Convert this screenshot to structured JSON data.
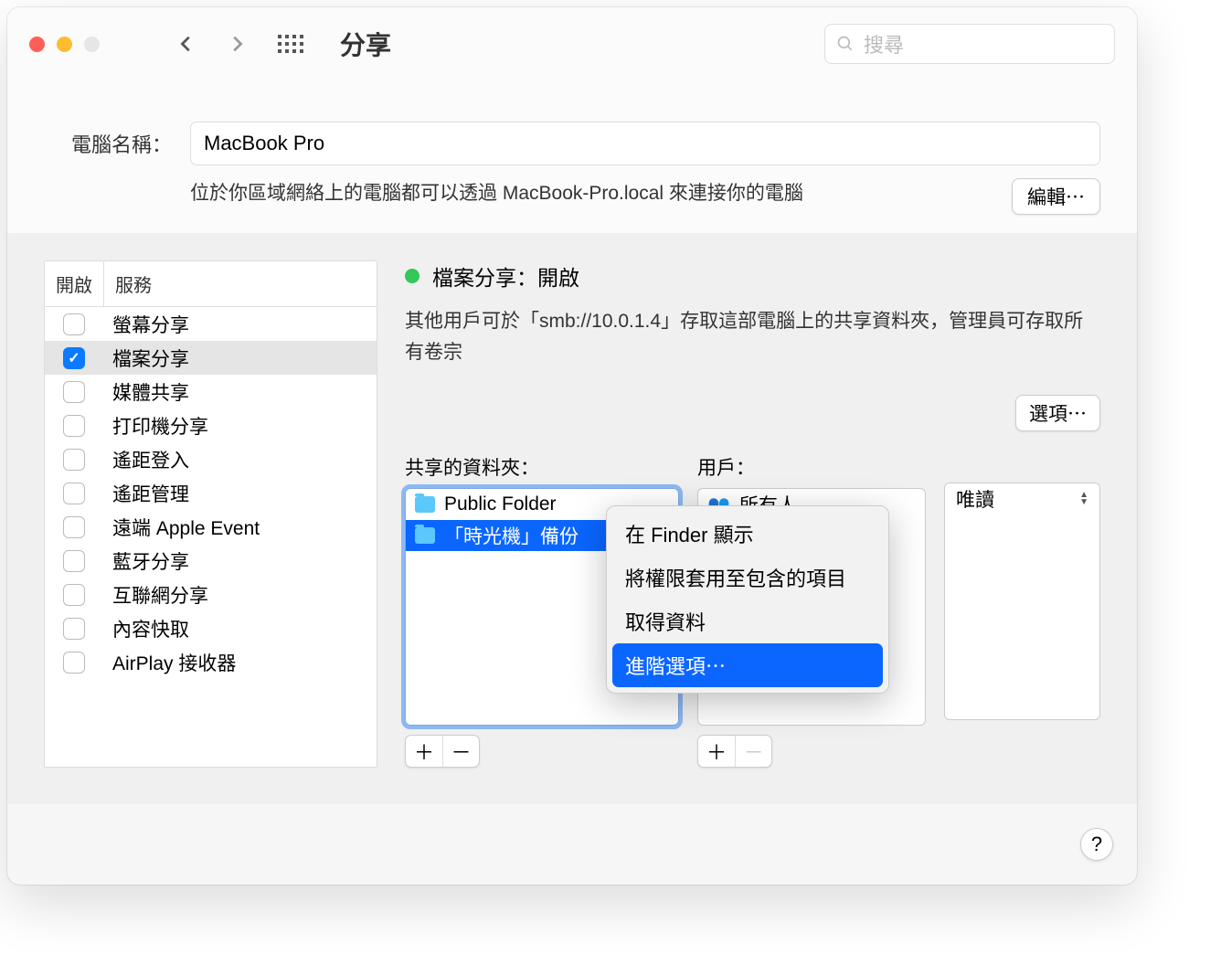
{
  "window_title": "分享",
  "search_placeholder": "搜尋",
  "computer_name_label": "電腦名稱：",
  "computer_name_value": "MacBook Pro",
  "computer_name_desc": "位於你區域網絡上的電腦都可以透過 MacBook-Pro.local 來連接你的電腦",
  "edit_button": "編輯⋯",
  "services_header_on": "開啟",
  "services_header_service": "服務",
  "services": [
    {
      "label": "螢幕分享",
      "checked": false,
      "selected": false
    },
    {
      "label": "檔案分享",
      "checked": true,
      "selected": true
    },
    {
      "label": "媒體共享",
      "checked": false,
      "selected": false
    },
    {
      "label": "打印機分享",
      "checked": false,
      "selected": false
    },
    {
      "label": "遙距登入",
      "checked": false,
      "selected": false
    },
    {
      "label": "遙距管理",
      "checked": false,
      "selected": false
    },
    {
      "label": "遠端 Apple Event",
      "checked": false,
      "selected": false
    },
    {
      "label": "藍牙分享",
      "checked": false,
      "selected": false
    },
    {
      "label": "互聯網分享",
      "checked": false,
      "selected": false
    },
    {
      "label": "內容快取",
      "checked": false,
      "selected": false
    },
    {
      "label": "AirPlay 接收器",
      "checked": false,
      "selected": false
    }
  ],
  "status_title": "檔案分享：開啟",
  "status_desc": "其他用戶可於「smb://10.0.1.4」存取這部電腦上的共享資料夾，管理員可存取所有卷宗",
  "options_button": "選項⋯",
  "shared_folders_label": "共享的資料夾：",
  "shared_folders": [
    {
      "name": "Public Folder",
      "selected": false
    },
    {
      "name": "「時光機」備份",
      "selected": true
    }
  ],
  "users_label": "用戶：",
  "users": [
    {
      "name": "所有人"
    }
  ],
  "permission_value": "唯讀",
  "context_menu": {
    "items": [
      {
        "label": "在 Finder 顯示",
        "hl": false
      },
      {
        "label": "將權限套用至包含的項目",
        "hl": false
      },
      {
        "label": "取得資料",
        "hl": false
      },
      {
        "label": "進階選項⋯",
        "hl": true
      }
    ]
  },
  "help": "?"
}
